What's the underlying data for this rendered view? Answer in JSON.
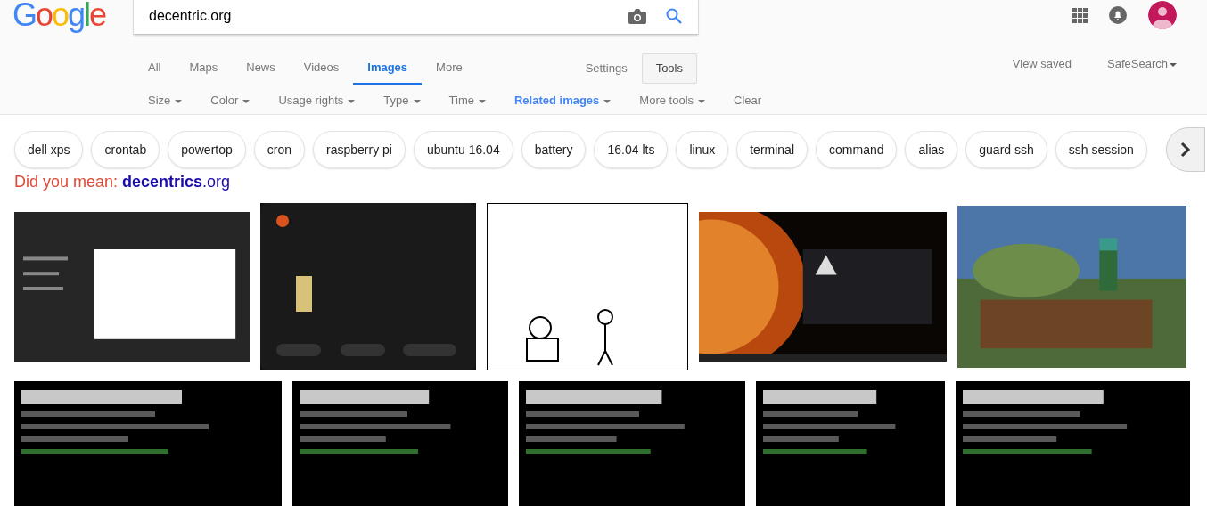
{
  "logo": "Google",
  "search": {
    "value": "decentric.org"
  },
  "tabs": [
    {
      "label": "All",
      "selected": false
    },
    {
      "label": "Maps",
      "selected": false
    },
    {
      "label": "News",
      "selected": false
    },
    {
      "label": "Videos",
      "selected": false
    },
    {
      "label": "Images",
      "selected": true
    },
    {
      "label": "More",
      "selected": false
    }
  ],
  "settings": "Settings",
  "tools": "Tools",
  "view_saved": "View saved",
  "safesearch": "SafeSearch",
  "filters": [
    {
      "label": "Size",
      "selected": false
    },
    {
      "label": "Color",
      "selected": false
    },
    {
      "label": "Usage rights",
      "selected": false
    },
    {
      "label": "Type",
      "selected": false
    },
    {
      "label": "Time",
      "selected": false
    },
    {
      "label": "Related images",
      "selected": true
    },
    {
      "label": "More tools",
      "selected": false
    }
  ],
  "clear": "Clear",
  "chips": [
    "dell xps",
    "crontab",
    "powertop",
    "cron",
    "raspberry pi",
    "ubuntu 16.04",
    "battery",
    "16.04 lts",
    "linux",
    "terminal",
    "command",
    "alias",
    "guard ssh",
    "ssh session"
  ],
  "did_you_mean": {
    "label": "Did you mean:",
    "suggestion": "**decentrics**.org"
  }
}
